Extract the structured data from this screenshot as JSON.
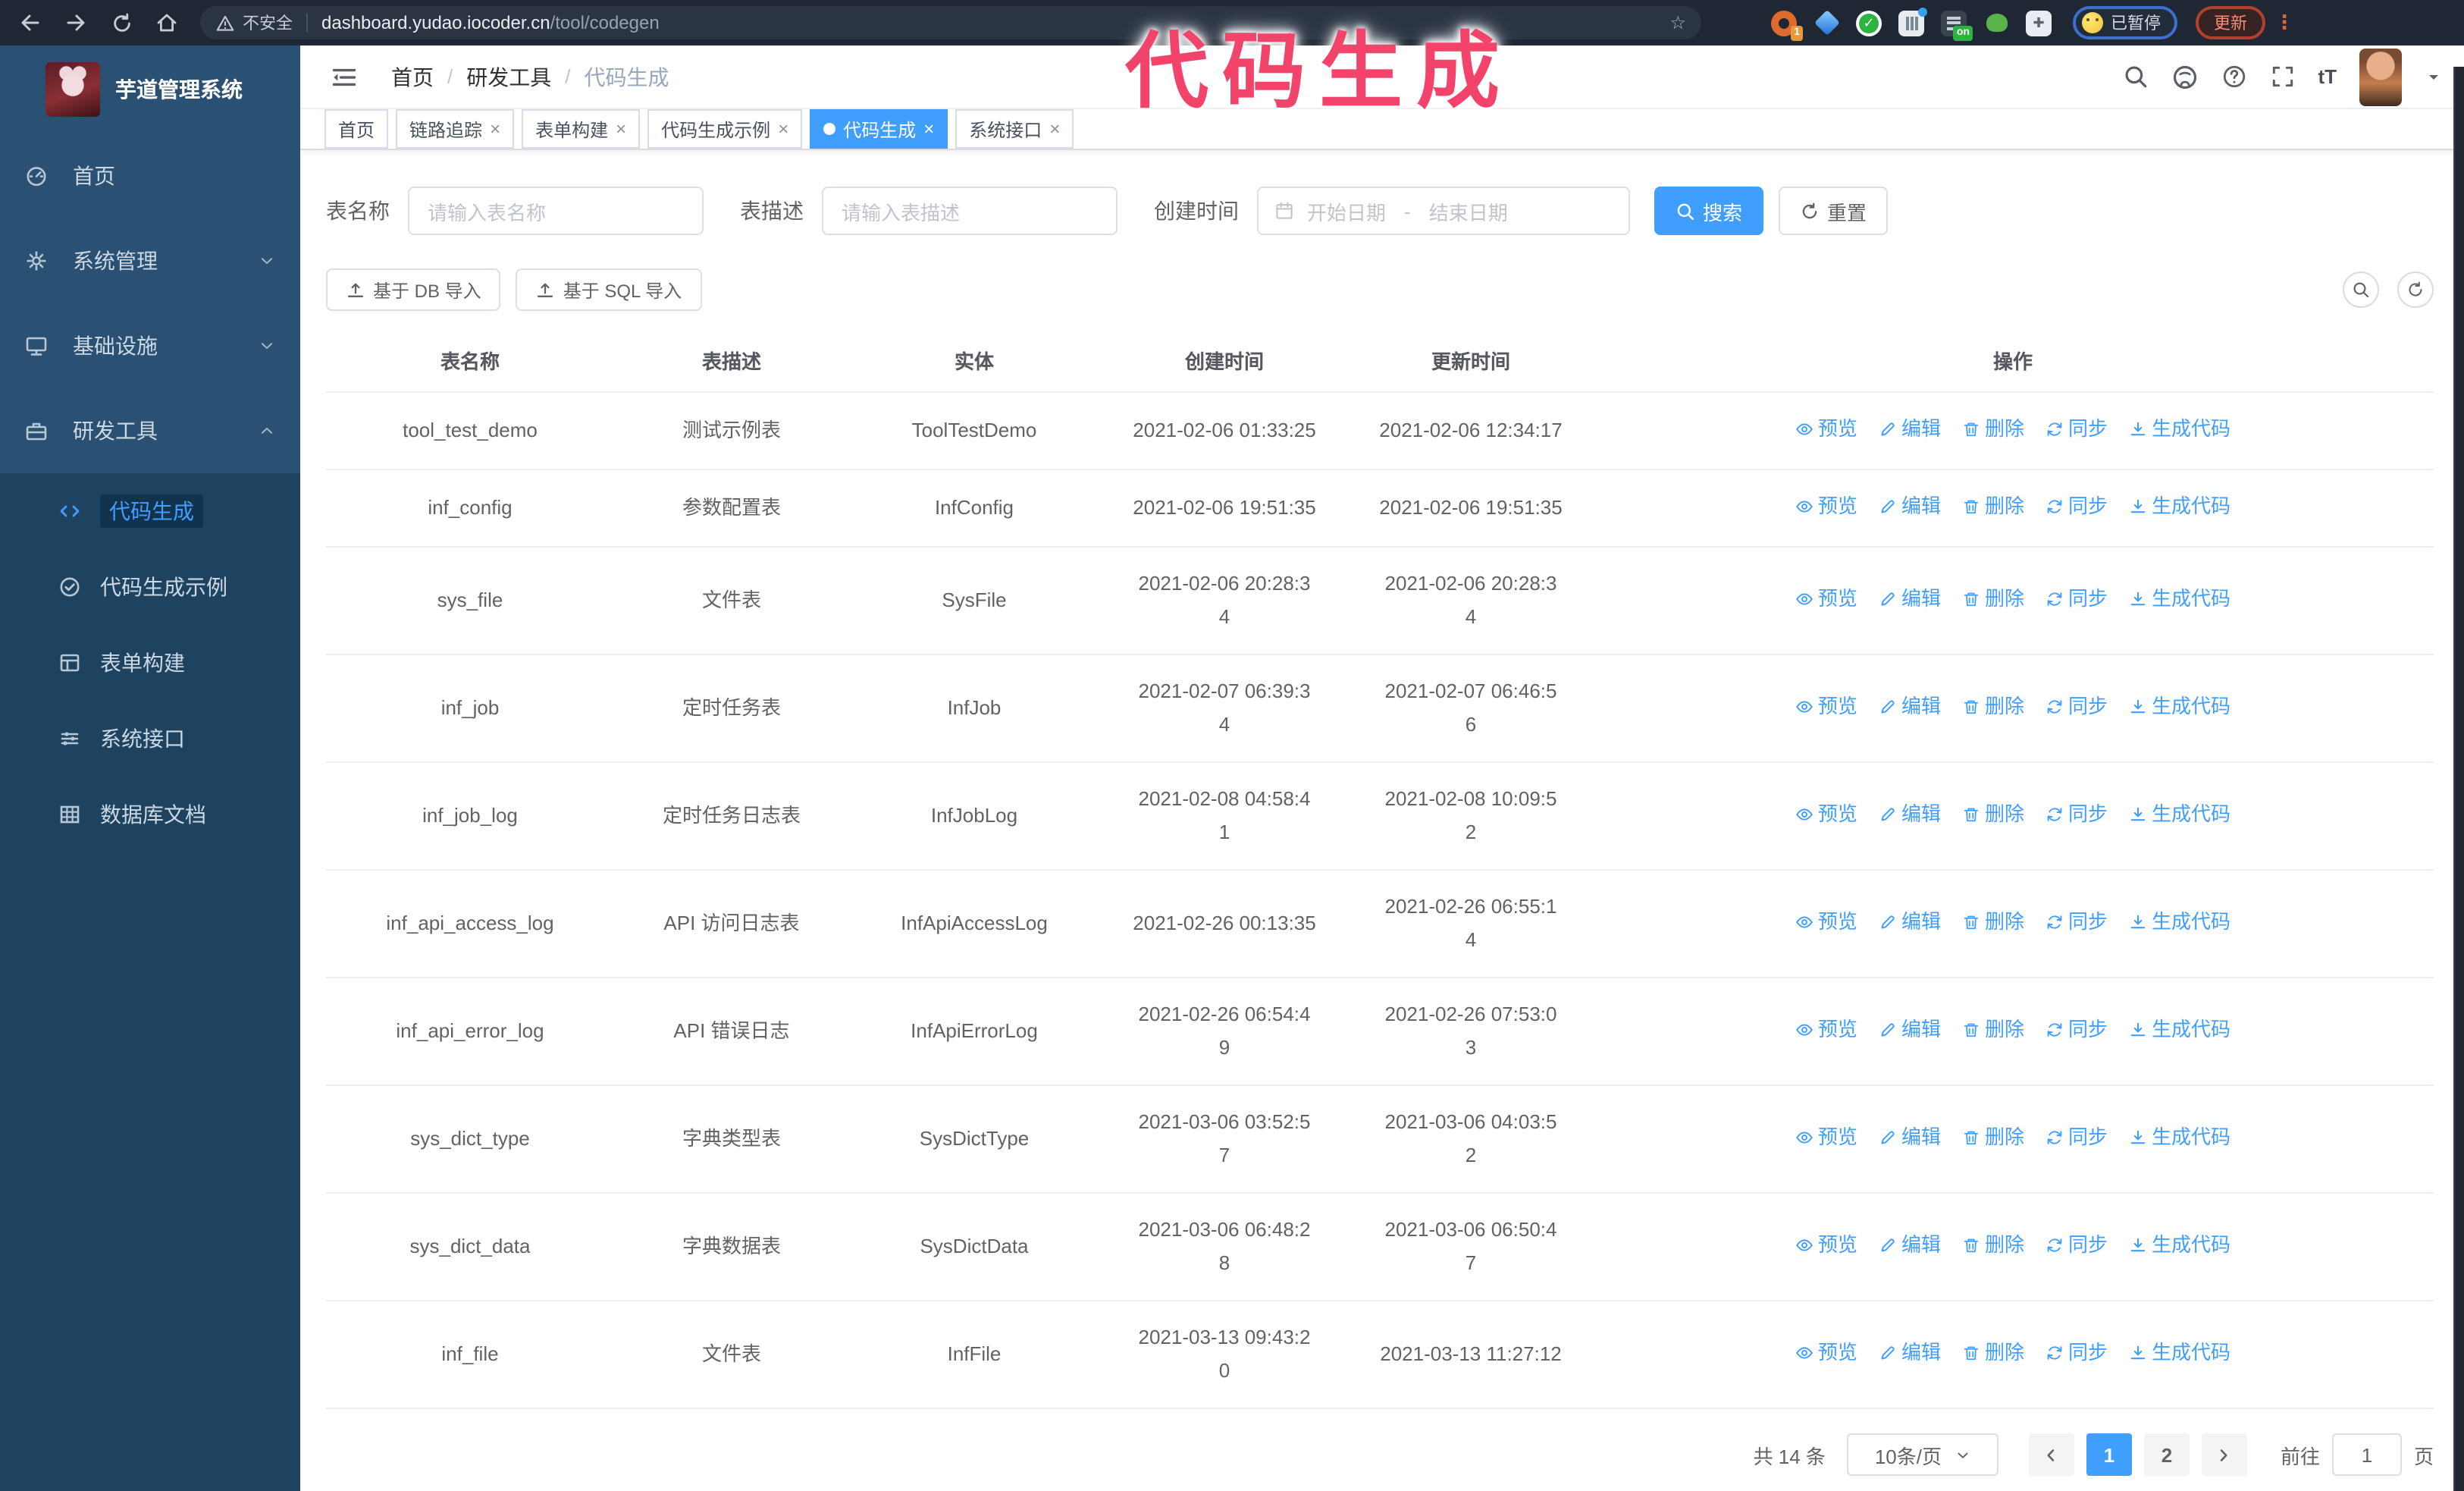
{
  "colors": {
    "accent": "#409eff",
    "chrome_bg": "#1f2734",
    "sidebar_top": "#2a5173",
    "sidebar_sub": "#1e4361",
    "annotation_pink": "#f2436b",
    "update_red": "#b3402e",
    "paused_blue": "#3d6fd0",
    "link_blue": "#409eff"
  },
  "annotation": {
    "text": "代码生成"
  },
  "chrome": {
    "security_label": "不安全",
    "url_host": "dashboard.yudao.iocoder.cn",
    "url_path": "/tool/codegen",
    "star_icon": "☆",
    "extensions": [
      {
        "name": "extension-orange-ring",
        "badge": "1"
      },
      {
        "name": "extension-blue-gem",
        "badge": ""
      },
      {
        "name": "extension-green-check",
        "badge": ""
      },
      {
        "name": "extension-gray-bars",
        "badge": ""
      },
      {
        "name": "extension-dark-switch",
        "badge": "on"
      },
      {
        "name": "extension-green-frog",
        "badge": ""
      },
      {
        "name": "extension-puzzle",
        "badge": ""
      }
    ],
    "paused_label": "已暂停",
    "update_label": "更新",
    "menu_dots": "⋮"
  },
  "sidebar": {
    "title": "芋道管理系统",
    "menu": [
      {
        "icon": "dashboard",
        "label": "首页",
        "chevron": ""
      },
      {
        "icon": "gear",
        "label": "系统管理",
        "chevron": "down"
      },
      {
        "icon": "infra",
        "label": "基础设施",
        "chevron": "down"
      },
      {
        "icon": "toolbox",
        "label": "研发工具",
        "chevron": "up",
        "children": [
          {
            "icon": "code",
            "label": "代码生成",
            "active": true
          },
          {
            "icon": "example",
            "label": "代码生成示例"
          },
          {
            "icon": "form",
            "label": "表单构建"
          },
          {
            "icon": "api",
            "label": "系统接口"
          },
          {
            "icon": "db",
            "label": "数据库文档"
          }
        ]
      }
    ]
  },
  "navbar": {
    "breadcrumb": [
      "首页",
      "研发工具",
      "代码生成"
    ],
    "font_icon_label": "tT"
  },
  "tabsbar": {
    "tabs": [
      {
        "label": "首页",
        "closable": false,
        "active": false
      },
      {
        "label": "链路追踪",
        "closable": true,
        "active": false
      },
      {
        "label": "表单构建",
        "closable": true,
        "active": false
      },
      {
        "label": "代码生成示例",
        "closable": true,
        "active": false
      },
      {
        "label": "代码生成",
        "closable": true,
        "active": true
      },
      {
        "label": "系统接口",
        "closable": true,
        "active": false
      }
    ]
  },
  "form": {
    "table_name_label": "表名称",
    "table_name_placeholder": "请输入表名称",
    "table_desc_label": "表描述",
    "table_desc_placeholder": "请输入表描述",
    "create_time_label": "创建时间",
    "date_start_placeholder": "开始日期",
    "date_range_separator": "-",
    "date_end_placeholder": "结束日期",
    "search_label": "搜索",
    "reset_label": "重置"
  },
  "toolbar": {
    "import_db_label": "基于 DB 导入",
    "import_sql_label": "基于 SQL 导入"
  },
  "table": {
    "headers": [
      "表名称",
      "表描述",
      "实体",
      "创建时间",
      "更新时间",
      "操作"
    ],
    "action_labels": [
      {
        "icon": "eye",
        "label": "预览"
      },
      {
        "icon": "edit",
        "label": "编辑"
      },
      {
        "icon": "trash",
        "label": "删除"
      },
      {
        "icon": "sync",
        "label": "同步"
      },
      {
        "icon": "download",
        "label": "生成代码"
      }
    ],
    "rows": [
      {
        "name": "tool_test_demo",
        "desc": "测试示例表",
        "entity": "ToolTestDemo",
        "created": [
          "2021-02-06 01:33:25"
        ],
        "updated": [
          "2021-02-06 12:34:17"
        ]
      },
      {
        "name": "inf_config",
        "desc": "参数配置表",
        "entity": "InfConfig",
        "created": [
          "2021-02-06 19:51:35"
        ],
        "updated": [
          "2021-02-06 19:51:35"
        ]
      },
      {
        "name": "sys_file",
        "desc": "文件表",
        "entity": "SysFile",
        "created": [
          "2021-02-06 20:28:3",
          "4"
        ],
        "updated": [
          "2021-02-06 20:28:3",
          "4"
        ]
      },
      {
        "name": "inf_job",
        "desc": "定时任务表",
        "entity": "InfJob",
        "created": [
          "2021-02-07 06:39:3",
          "4"
        ],
        "updated": [
          "2021-02-07 06:46:5",
          "6"
        ]
      },
      {
        "name": "inf_job_log",
        "desc": "定时任务日志表",
        "entity": "InfJobLog",
        "created": [
          "2021-02-08 04:58:4",
          "1"
        ],
        "updated": [
          "2021-02-08 10:09:5",
          "2"
        ]
      },
      {
        "name": "inf_api_access_log",
        "desc": "API 访问日志表",
        "entity": "InfApiAccessLog",
        "created": [
          "2021-02-26 00:13:35"
        ],
        "updated": [
          "2021-02-26 06:55:1",
          "4"
        ]
      },
      {
        "name": "inf_api_error_log",
        "desc": "API 错误日志",
        "entity": "InfApiErrorLog",
        "created": [
          "2021-02-26 06:54:4",
          "9"
        ],
        "updated": [
          "2021-02-26 07:53:0",
          "3"
        ]
      },
      {
        "name": "sys_dict_type",
        "desc": "字典类型表",
        "entity": "SysDictType",
        "created": [
          "2021-03-06 03:52:5",
          "7"
        ],
        "updated": [
          "2021-03-06 04:03:5",
          "2"
        ]
      },
      {
        "name": "sys_dict_data",
        "desc": "字典数据表",
        "entity": "SysDictData",
        "created": [
          "2021-03-06 06:48:2",
          "8"
        ],
        "updated": [
          "2021-03-06 06:50:4",
          "7"
        ]
      },
      {
        "name": "inf_file",
        "desc": "文件表",
        "entity": "InfFile",
        "created": [
          "2021-03-13 09:43:2",
          "0"
        ],
        "updated": [
          "2021-03-13 11:27:12"
        ]
      }
    ]
  },
  "pagination": {
    "total_label": "共 14 条",
    "page_size_label": "10条/页",
    "pages": [
      {
        "label": "1",
        "active": true
      },
      {
        "label": "2",
        "active": false
      }
    ],
    "goto_label": "前往",
    "goto_value": "1",
    "page_suffix_label": "页"
  }
}
